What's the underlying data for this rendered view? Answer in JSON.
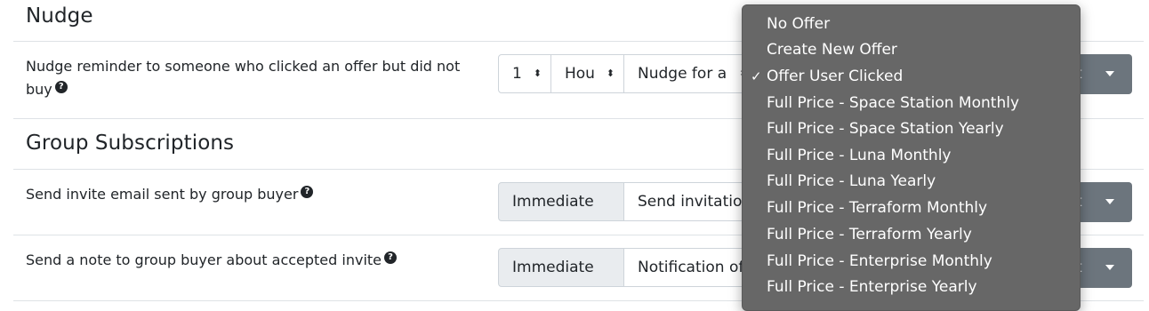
{
  "sections": {
    "nudge_title": "Nudge",
    "group_title": "Group Subscriptions"
  },
  "rows": {
    "nudge_label": "Nudge reminder to someone who clicked an offer but did not buy",
    "invite_label": "Send invite email sent by group buyer",
    "note_label": "Send a note to group buyer about accepted invite",
    "help_glyph": "?"
  },
  "controls": {
    "nudge_count": "1",
    "nudge_unit": "Hou",
    "nudge_template": "Nudge for a",
    "invite_timing": "Immediate",
    "invite_template": "Send invitation",
    "note_timing": "Immediate",
    "note_template": "Notification of",
    "action_partial": "t"
  },
  "dropdown": {
    "selected_index": 2,
    "check_glyph": "✓",
    "options": [
      "No Offer",
      "Create New Offer",
      "Offer User Clicked",
      "Full Price - Space Station Monthly",
      "Full Price - Space Station Yearly",
      "Full Price - Luna Monthly",
      "Full Price - Luna Yearly",
      "Full Price - Terraform Monthly",
      "Full Price - Terraform Yearly",
      "Full Price - Enterprise Monthly",
      "Full Price - Enterprise Yearly"
    ]
  },
  "icons": {
    "updown_arrows": "updown-arrows-icon",
    "caret": "caret-down-icon",
    "help": "help-icon",
    "check": "check-icon"
  },
  "colors": {
    "dropdown_bg": "#676767",
    "button_bg": "#6c757d",
    "gray_box": "#e9ecef",
    "border": "#ced4da"
  }
}
